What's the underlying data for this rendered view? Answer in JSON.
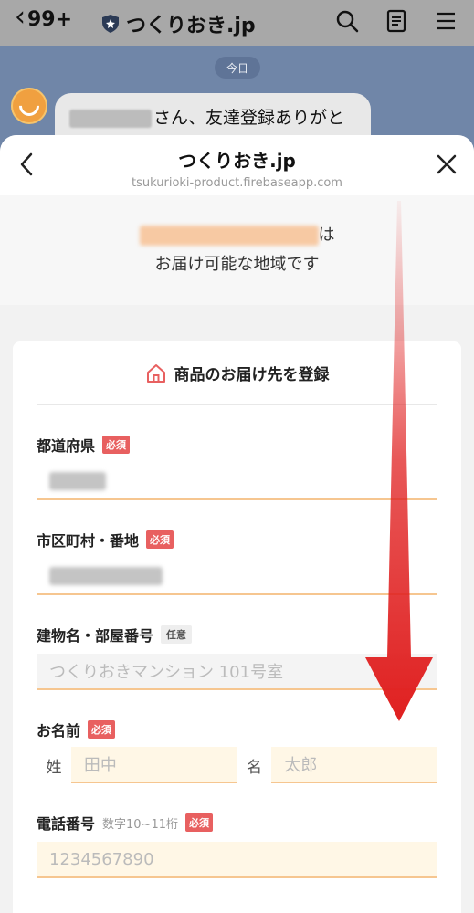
{
  "line": {
    "back_count": "99+",
    "title": "つくりおき.jp"
  },
  "chat": {
    "date": "今日",
    "message": "さん、友達登録ありがと"
  },
  "sheet": {
    "title": "つくりおき.jp",
    "domain": "tsukurioki-product.firebaseapp.com",
    "area_suffix": "は",
    "area_message": "お届け可能な地域です"
  },
  "form": {
    "heading": "商品のお届け先を登録",
    "prefecture": {
      "label": "都道府県",
      "badge": "必須"
    },
    "city": {
      "label": "市区町村・番地",
      "badge": "必須"
    },
    "building": {
      "label": "建物名・部屋番号",
      "badge": "任意",
      "placeholder": "つくりおきマンション 101号室"
    },
    "name": {
      "label": "お名前",
      "badge": "必須",
      "last_prefix": "姓",
      "last_placeholder": "田中",
      "first_prefix": "名",
      "first_placeholder": "太郎"
    },
    "phone": {
      "label": "電話番号",
      "hint": "数字10~11桁",
      "badge": "必須",
      "placeholder": "1234567890"
    }
  },
  "icons": [
    "chevron-left-icon",
    "shield-icon",
    "search-icon",
    "note-icon",
    "menu-icon",
    "close-icon",
    "home-icon",
    "arrow-down-icon"
  ],
  "colors": {
    "accent": "#f6c690",
    "required": "#e86060",
    "chat_bg": "#7086a8",
    "arrow": "#e02020"
  }
}
